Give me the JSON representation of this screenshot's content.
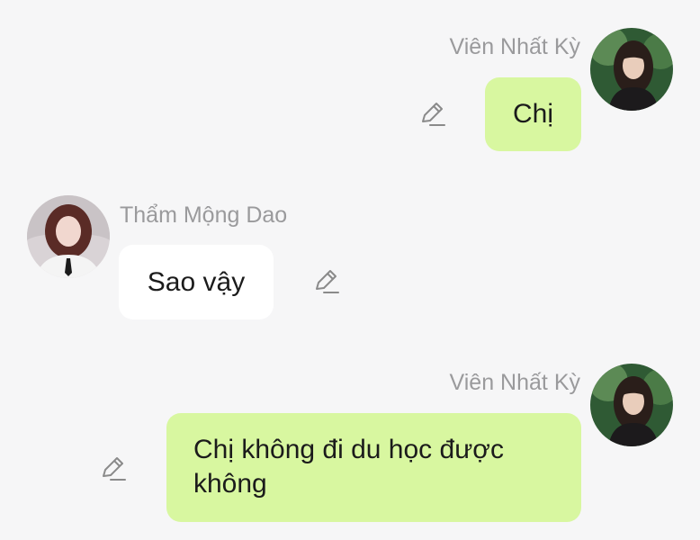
{
  "messages": [
    {
      "sender": "Viên Nhất Kỳ",
      "text": "Chị",
      "side": "right"
    },
    {
      "sender": "Thẩm Mộng Dao",
      "text": "Sao vậy",
      "side": "left"
    },
    {
      "sender": "Viên Nhất Kỳ",
      "text": "Chị không đi du học được không",
      "side": "right"
    }
  ],
  "colors": {
    "my_bubble": "#d8f7a0",
    "their_bubble": "#ffffff",
    "background": "#f6f6f7",
    "name_text": "#9a9a9c"
  },
  "icons": {
    "edit": "pencil-edit-icon"
  }
}
